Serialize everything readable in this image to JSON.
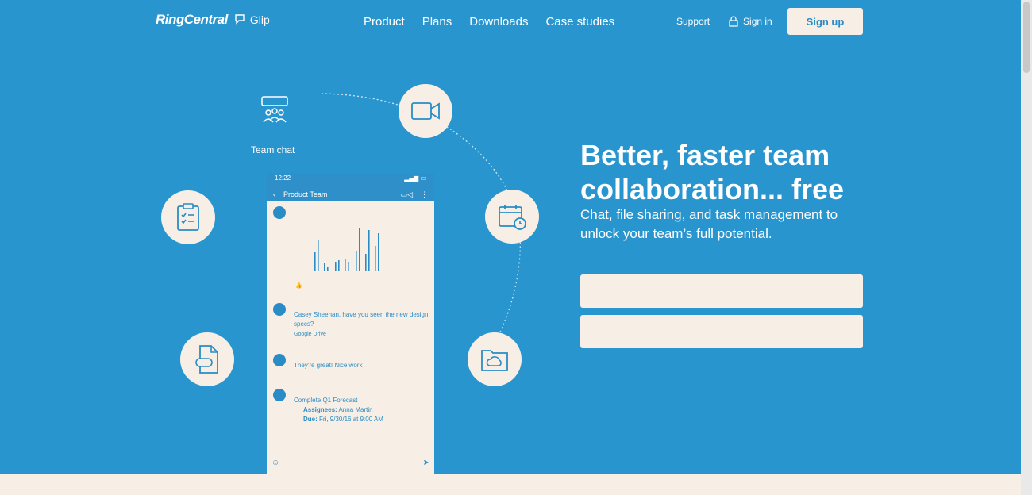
{
  "header": {
    "brand": "RingCentral",
    "product": "Glip",
    "nav": [
      "Product",
      "Plans",
      "Downloads",
      "Case studies"
    ],
    "support": "Support",
    "signin": "Sign in",
    "signup": "Sign up"
  },
  "hero": {
    "title_line1": "Better, faster team",
    "title_line2": "collaboration... free",
    "subtitle": "Chat, file sharing, and task management to unlock your team’s full potential.",
    "email_placeholder": ""
  },
  "features": {
    "team_chat_label": "Team chat"
  },
  "phone": {
    "time": "12:22",
    "team": "Product Team",
    "messages": [
      {
        "author": "",
        "time": "",
        "text": ""
      },
      {
        "author": "",
        "time": "",
        "text": "Casey Sheehan, have you seen the new design specs?"
      },
      {
        "author": "",
        "time": "",
        "text": "They're great! Nice work"
      },
      {
        "author": "",
        "time": "",
        "text": "Complete Q1 Forecast"
      }
    ],
    "task_assignees_label": "Assignees:",
    "task_assignees": "Anna Martin",
    "task_due_label": "Due:",
    "task_due": "Fri, 9/30/16 at 9:00 AM",
    "google_drive": "Google Drive"
  },
  "colors": {
    "background": "#2895cf",
    "cream": "#f7efe6",
    "accent": "#2a8cc6"
  }
}
